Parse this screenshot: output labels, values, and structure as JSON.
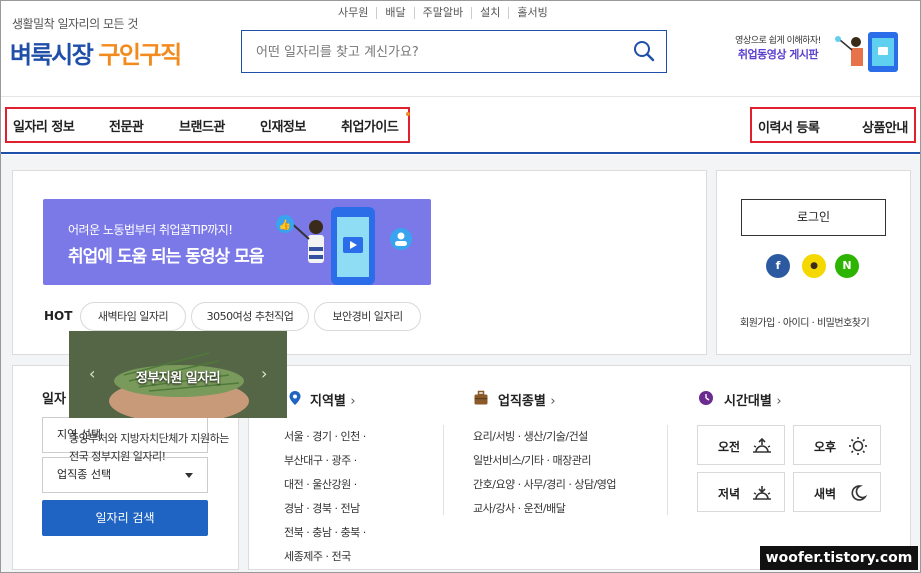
{
  "header": {
    "tagline": "생활밀착 일자리의 모든 것",
    "logo_main": "벼룩시장",
    "logo_sub": "구인구직",
    "top_links": [
      "사무원",
      "배달",
      "주말알바",
      "설치",
      "홀서빙"
    ],
    "search_placeholder": "어떤 일자리를 찾고 계신가요?",
    "promo_line1": "영상으로 쉽게 이해하자!",
    "promo_line2": "취업동영상 게시판"
  },
  "nav": {
    "left": [
      "일자리 정보",
      "전문관",
      "브랜드관",
      "인재정보",
      "취업가이드"
    ],
    "right": [
      "이력서 등록",
      "상품안내"
    ]
  },
  "banner": {
    "line1": "어려운 노동법부터 취업꿀TIP까지!",
    "line2": "취업에 도움 되는 동영상 모음"
  },
  "hot": {
    "label": "HOT",
    "chips": [
      "새벽타임 일자리",
      "3050여성 추천직업",
      "보안경비 일자리"
    ]
  },
  "login": {
    "button": "로그인",
    "sns": [
      {
        "name": "facebook",
        "glyph": "f",
        "color": "#2c5aa0"
      },
      {
        "name": "kakao",
        "glyph": "●",
        "color": "#f5d800"
      },
      {
        "name": "naver",
        "glyph": "N",
        "color": "#2db400"
      }
    ],
    "links": "회원가입 · 아이디 · 비밀번호찾기"
  },
  "job_search": {
    "title": "일자",
    "select1": "지역 선택",
    "select2": "업직종 선택",
    "button": "일자리 검색"
  },
  "gov_popup": {
    "title": "정부지원 일자리",
    "desc1": "중앙부처와 지방자치단체가 지원하는",
    "desc2": "전국 정부지원 일자리!"
  },
  "region": {
    "title": "지역별",
    "lines": [
      "서울 · 경기 · 인천 ·",
      "부산대구 · 광주 ·",
      "대전 · 울산강원 ·",
      "경남 · 경북 · 전남",
      "전북 · 충남 · 충북 ·",
      "세종제주 · 전국"
    ]
  },
  "industry": {
    "title": "업직종별",
    "lines": [
      "요리/서빙 · 생산/기술/건설",
      "일반서비스/기타 · 매장관리",
      "간호/요양 · 사무/경리 · 상담/영업",
      "교사/강사 · 운전/배달"
    ]
  },
  "time": {
    "title": "시간대별",
    "slots": [
      "오전",
      "오후",
      "저녁",
      "새벽"
    ]
  },
  "watermark": "woofer.tistory.com",
  "colors": {
    "brand_blue": "#1f4fa8",
    "brand_orange": "#f28a1d",
    "highlight_red": "#e0202f",
    "button_blue": "#1f64c2"
  }
}
